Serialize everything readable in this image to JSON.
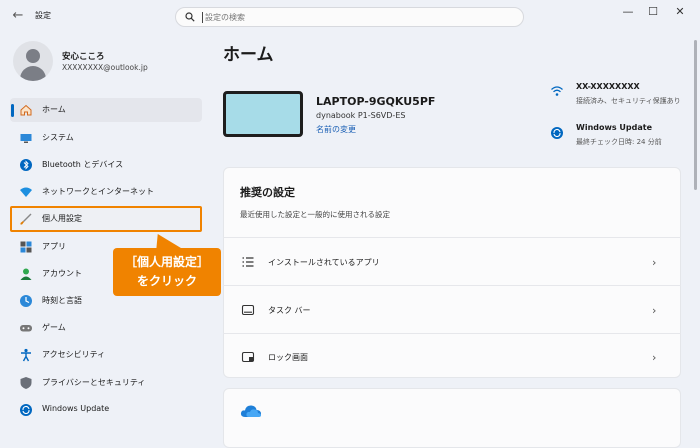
{
  "window": {
    "title": "設定",
    "search_placeholder": "設定の検索",
    "controls": [
      "—",
      "☐",
      "✕"
    ]
  },
  "user": {
    "name": "安心こころ",
    "email": "XXXXXXXX@outlook.jp"
  },
  "sidebar": {
    "items": [
      {
        "label": "ホーム",
        "icon": "home-icon",
        "selected": true
      },
      {
        "label": "システム",
        "icon": "system-icon"
      },
      {
        "label": "Bluetooth とデバイス",
        "icon": "bluetooth-icon"
      },
      {
        "label": "ネットワークとインターネット",
        "icon": "wifi-icon"
      },
      {
        "label": "個人用設定",
        "icon": "brush-icon"
      },
      {
        "label": "アプリ",
        "icon": "apps-icon"
      },
      {
        "label": "アカウント",
        "icon": "account-icon"
      },
      {
        "label": "時刻と言語",
        "icon": "time-language-icon"
      },
      {
        "label": "ゲーム",
        "icon": "gamepad-icon"
      },
      {
        "label": "アクセシビリティ",
        "icon": "accessibility-icon"
      },
      {
        "label": "プライバシーとセキュリティ",
        "icon": "shield-icon"
      },
      {
        "label": "Windows Update",
        "icon": "update-icon"
      }
    ]
  },
  "callout": {
    "line1": "［個人用設定］",
    "line2": "をクリック",
    "color": "#f08300"
  },
  "main": {
    "title": "ホーム",
    "device": {
      "name": "LAPTOP-9GQKU5PF",
      "model": "dynabook P1-S6VD-ES",
      "rename": "名前の変更"
    },
    "status": [
      {
        "title": "XX-XXXXXXXX",
        "sub": "接続済み、セキュリティ保護あり",
        "icon": "wifi-icon"
      },
      {
        "title": "Windows Update",
        "sub": "最終チェック日時: 24 分前",
        "icon": "update-icon"
      }
    ],
    "recommended": {
      "title": "推奨の設定",
      "subtitle": "最近使用した設定と一般的に使用される設定",
      "rows": [
        {
          "label": "インストールされているアプリ",
          "icon": "installed-apps-icon"
        },
        {
          "label": "タスク バー",
          "icon": "taskbar-icon"
        },
        {
          "label": "ロック画面",
          "icon": "lock-screen-icon"
        }
      ]
    },
    "next_card_icon": "onedrive-cloud-icon"
  },
  "colors": {
    "accent": "#0067c0",
    "highlight": "#f08300",
    "background": "#eef1f7"
  }
}
